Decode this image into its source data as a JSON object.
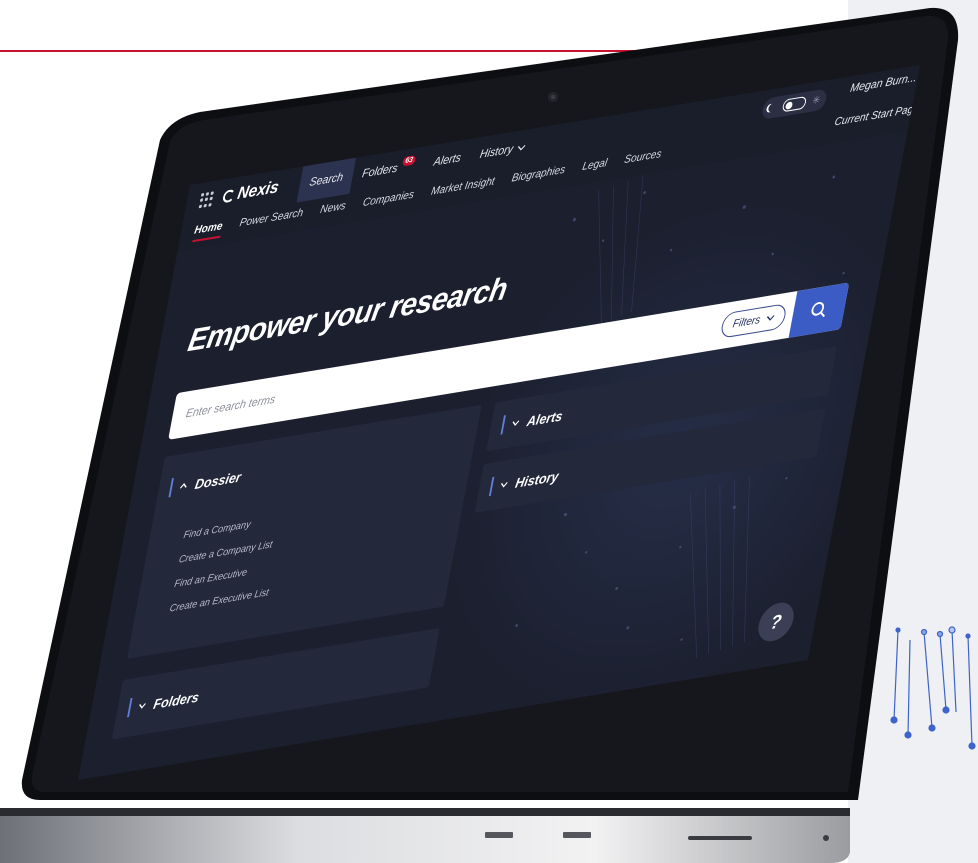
{
  "app": {
    "logo": "Nexis",
    "user_name": "Megan Burn...",
    "start_page_label": "Current Start Page"
  },
  "primary_nav": [
    {
      "label": "Search",
      "active": true
    },
    {
      "label": "Folders",
      "badge": "63"
    },
    {
      "label": "Alerts"
    },
    {
      "label": "History",
      "dropdown": true
    }
  ],
  "secondary_nav": [
    {
      "label": "Home",
      "active": true
    },
    {
      "label": "Power Search"
    },
    {
      "label": "News"
    },
    {
      "label": "Companies"
    },
    {
      "label": "Market Insight"
    },
    {
      "label": "Biographies"
    },
    {
      "label": "Legal"
    },
    {
      "label": "Sources"
    }
  ],
  "hero": {
    "title": "Empower your research"
  },
  "search": {
    "placeholder": "Enter search terms",
    "value": "",
    "filters_label": "Filters"
  },
  "panels": {
    "dossier": {
      "title": "Dossier",
      "expanded": true,
      "links": [
        "Find a Company",
        "Create a Company List",
        "Find an Executive",
        "Create an Executive List"
      ]
    },
    "alerts": {
      "title": "Alerts",
      "expanded": false
    },
    "history": {
      "title": "History",
      "expanded": false
    },
    "folders": {
      "title": "Folders",
      "expanded": false
    }
  },
  "help_label": "?",
  "colors": {
    "accent_red": "#c41230",
    "screen_bg": "#1b1f2e",
    "search_button": "#3c5cc5",
    "panel_bg": "#23283a"
  }
}
